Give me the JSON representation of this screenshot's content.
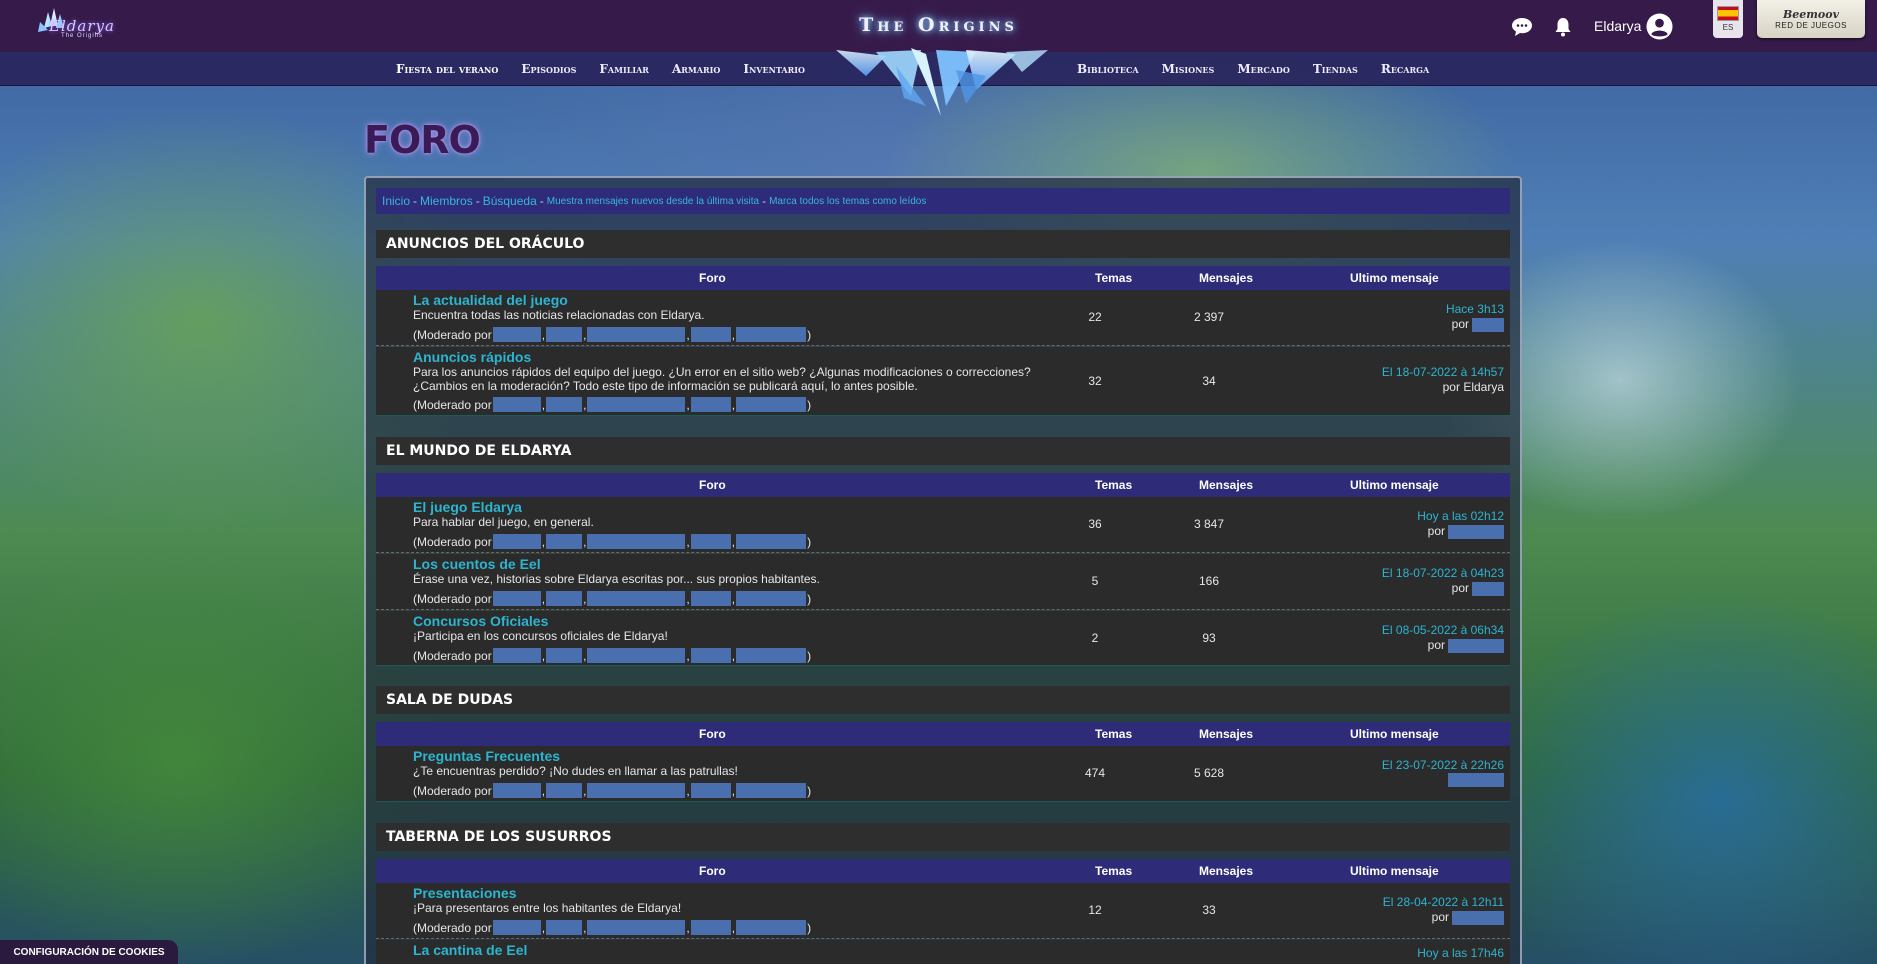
{
  "topbar": {
    "logo_text": "Eldarya",
    "logo_sub": "The Origins",
    "site_title": "The Origins",
    "username": "Eldarya",
    "lang_code": "ES",
    "gamenet_brand": "Beemoov",
    "gamenet_label": "RED DE JUEGOS"
  },
  "nav": {
    "left": [
      "Fiesta del verano",
      "Episodios",
      "Familiar",
      "Armario",
      "Inventario"
    ],
    "right": [
      "Biblioteca",
      "Misiones",
      "Mercado",
      "Tiendas",
      "Recarga"
    ]
  },
  "page": {
    "title": "FORO"
  },
  "breadcrumb": {
    "inicio": "Inicio",
    "miembros": "Miembros",
    "busqueda": "Búsqueda",
    "nuevos": "Muestra mensajes nuevos desde la última visita",
    "marcar": "Marca todos los temas como leídos",
    "sep": "-"
  },
  "columns": {
    "foro": "Foro",
    "temas": "Temas",
    "mensajes": "Mensajes",
    "ultimo": "Ultimo mensaje"
  },
  "moderado_prefix": "(Moderado por",
  "por": "por",
  "categories": [
    {
      "title": "ANUNCIOS DEL ORÁCULO",
      "forums": [
        {
          "title": "La actualidad del juego",
          "desc": "Encuentra todas las noticias relacionadas con Eldarya.",
          "temas": "22",
          "mensajes": "2 397",
          "last_date": "Hace 3h13",
          "last_by": ""
        },
        {
          "title": "Anuncios rápidos",
          "desc": "Para los anuncios rápidos del equipo del juego. ¿Un error en el sitio web? ¿Algunas modificaciones o correcciones? ¿Cambios en la moderación? Todo este tipo de información se publicará aquí, lo antes posible.",
          "temas": "32",
          "mensajes": "34",
          "last_date": "El 18-07-2022 à 14h57",
          "last_by": "Eldarya"
        }
      ]
    },
    {
      "title": "EL MUNDO DE ELDARYA",
      "forums": [
        {
          "title": "El juego Eldarya",
          "desc": "Para hablar del juego, en general.",
          "temas": "36",
          "mensajes": "3 847",
          "last_date": "Hoy a las 02h12",
          "last_by": ""
        },
        {
          "title": "Los cuentos de Eel",
          "desc": "Érase una vez, historias sobre Eldarya escritas por... sus propios habitantes.",
          "temas": "5",
          "mensajes": "166",
          "last_date": "El 18-07-2022 à 04h23",
          "last_by": ""
        },
        {
          "title": "Concursos Oficiales",
          "desc": "¡Participa en los concursos oficiales de Eldarya!",
          "temas": "2",
          "mensajes": "93",
          "last_date": "El 08-05-2022 à 06h34",
          "last_by": ""
        }
      ]
    },
    {
      "title": "SALA DE DUDAS",
      "forums": [
        {
          "title": "Preguntas Frecuentes",
          "desc": "¿Te encuentras perdido? ¡No dudes en llamar a las patrullas!",
          "temas": "474",
          "mensajes": "5 628",
          "last_date": "El 23-07-2022 à 22h26",
          "last_by": ""
        }
      ]
    },
    {
      "title": "TABERNA DE LOS SUSURROS",
      "forums": [
        {
          "title": "Presentaciones",
          "desc": "¡Para presentaros entre los habitantes de Eldarya!",
          "temas": "12",
          "mensajes": "33",
          "last_date": "El 28-04-2022 à 12h11",
          "last_by": ""
        },
        {
          "title": "La cantina de Eel",
          "desc": "",
          "temas": "",
          "mensajes": "",
          "last_date": "Hoy a las 17h46",
          "last_by": ""
        }
      ]
    }
  ],
  "cookie_button": "CONFIGURACIÓN DE COOKIES",
  "colors": {
    "topbar": "#361a4a",
    "navbar": "#28245c",
    "link": "#2cb5d0",
    "table_head": "#2e2c78",
    "row_bg": "#2b2b2b",
    "redaction": "#4a6fae"
  }
}
